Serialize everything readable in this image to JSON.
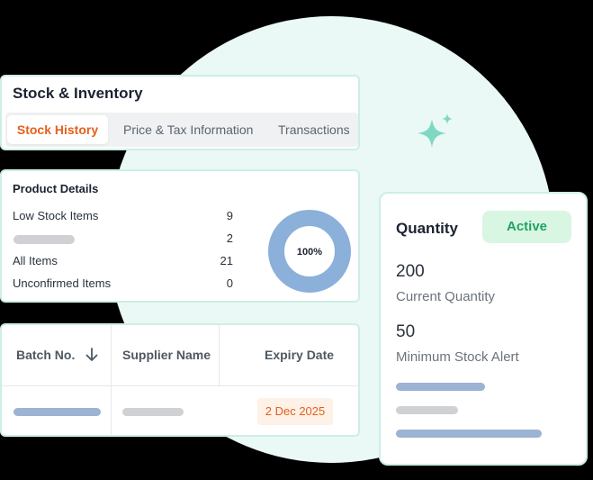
{
  "inventory": {
    "title": "Stock & Inventory",
    "tabs": [
      {
        "label": "Stock History",
        "active": true
      },
      {
        "label": "Price & Tax Information",
        "active": false
      },
      {
        "label": "Transactions",
        "active": false
      }
    ]
  },
  "product_details": {
    "title": "Product Details",
    "rows": [
      {
        "label": "Low Stock Items",
        "value": "9"
      },
      {
        "label": "",
        "value": "2"
      },
      {
        "label": "All Items",
        "value": "21"
      },
      {
        "label": "Unconfirmed Items",
        "value": "0"
      }
    ],
    "donut_label": "100%",
    "donut_percent": 100
  },
  "table": {
    "columns": [
      "Batch No.",
      "Supplier Name",
      "Expiry Date"
    ],
    "sort_icon": "arrow-down-icon",
    "row": {
      "expiry_date": "2 Dec 2025"
    }
  },
  "quantity": {
    "title": "Quantity",
    "status": "Active",
    "current_value": "200",
    "current_label": "Current Quantity",
    "min_value": "50",
    "min_label": "Minimum Stock Alert"
  },
  "colors": {
    "background": "#000000",
    "circle": "#eaf9f5",
    "accent_orange": "#e5601d",
    "active_green": "#21a360",
    "donut_blue": "#8bb0d9",
    "sparkle": "#7fd8c4"
  }
}
